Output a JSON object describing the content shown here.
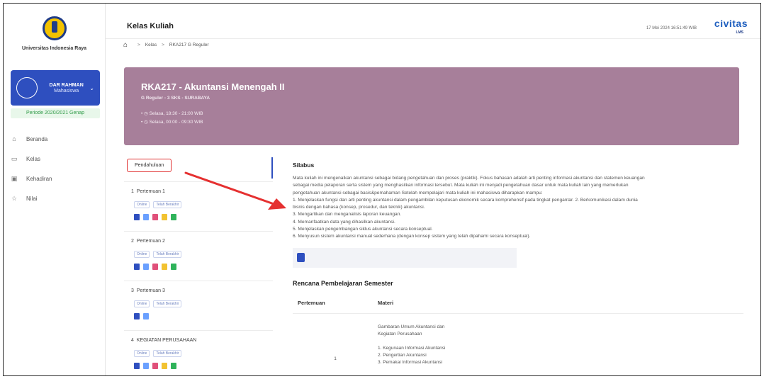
{
  "sidebar": {
    "university": "Universitas Indonesia Raya",
    "user": {
      "name": "DAR RAHMAN",
      "role": "Mahasiswa"
    },
    "period": "Periode 2020/2021 Genap",
    "nav": [
      {
        "label": "Beranda",
        "icon": "home-icon"
      },
      {
        "label": "Kelas",
        "icon": "folder-icon"
      },
      {
        "label": "Kehadiran",
        "icon": "calendar-icon"
      },
      {
        "label": "Nilai",
        "icon": "star-icon"
      }
    ]
  },
  "header": {
    "title": "Kelas Kuliah",
    "datetime": "17 Mei 2024 16:51:49 WIB",
    "brand": "civitas",
    "brand_sub": "LMS"
  },
  "breadcrumb": {
    "items": [
      "Kelas",
      "RKA217 G Reguler"
    ]
  },
  "course": {
    "title": "RKA217 - Akuntansi Menengah II",
    "subtitle": "G Reguler - 3 SKS - SURABAYA",
    "schedule": [
      "Selasa, 18:30 - 21:00 WIB",
      "Selasa, 00:00 - 09:30 WIB"
    ],
    "banner_color": "#a77f9a"
  },
  "meetings": {
    "intro": "Pendahuluan",
    "items": [
      {
        "number": "1",
        "title": "Pertemuan 1",
        "badges": [
          "Online",
          "Telah Berakhir"
        ],
        "icons": [
          "#2e4fbf",
          "#6aa0ff",
          "#e0507a",
          "#f2c230",
          "#2fb35a"
        ]
      },
      {
        "number": "2",
        "title": "Pertemuan 2",
        "badges": [
          "Online",
          "Telah Berakhir"
        ],
        "icons": [
          "#2e4fbf",
          "#6aa0ff",
          "#e0507a",
          "#f2c230",
          "#2fb35a"
        ]
      },
      {
        "number": "3",
        "title": "Pertemuan 3",
        "badges": [
          "Online",
          "Telah Berakhir"
        ],
        "icons": [
          "#2e4fbf",
          "#6aa0ff"
        ]
      },
      {
        "number": "4",
        "title": "KEGIATAN PERUSAHAAN",
        "badges": [
          "Online",
          "Telah Berakhir"
        ],
        "icons": [
          "#2e4fbf",
          "#6aa0ff",
          "#e0507a",
          "#f2c230",
          "#2fb35a"
        ]
      }
    ]
  },
  "silabus": {
    "title": "Silabus",
    "lines": [
      "Mata kuliah ini mengenalkan akuntansi sebagai bidang pengetahuan dan proses (praktik). Fokus bahasan adalah arti penting informasi akuntansi dan statemen keuangan",
      "sebagai media pelaporan serta sistem yang menghasilkan informasi tersebut. Mata kuliah ini menjadi pengetahuan dasar untuk mata kuliah lain yang memerlukan",
      "pengetahuan akuntansi sebagai basis&pemahaman Setelah mempelajari mata kuliah ini mahasiswa diharapkan mampu:",
      "1. Menjelaskan fungsi dan arti penting akuntansi dalam pengambilan keputusan ekonomik secara komprehensif pada tingkat pengantar. 2. Berkomunikasi dalam dunia",
      "bisnis dengan bahasa (konsep, prosedur, dan teknik) akuntansi.",
      "3. Mengartikan dan menganalisis laporan keuangan.",
      "4. Memanfaatkan data yang dihasilkan akuntansi.",
      "5. Menjelaskan pengembangan siklus akuntansi secara konseptual.",
      "6. Menyusun sistem akuntansi manual sederhana (dengan konsep sistem yang telah dipahami secara konseptual)."
    ]
  },
  "rps": {
    "title": "Rencana Pembelajaran Semester",
    "columns": [
      "Pertemuan",
      "Materi"
    ],
    "rows": [
      {
        "pertemuan": "1",
        "materi": [
          "Gambaran Umum Akuntansi dan",
          "Kegiatan Perusahaan",
          "",
          "1. Kegunaan Informasi Akuntansi",
          "2. Pengertian Akuntansi",
          "3. Pemakai Informasi Akuntansi"
        ]
      }
    ]
  },
  "annotation": {
    "color": "#e53030"
  }
}
